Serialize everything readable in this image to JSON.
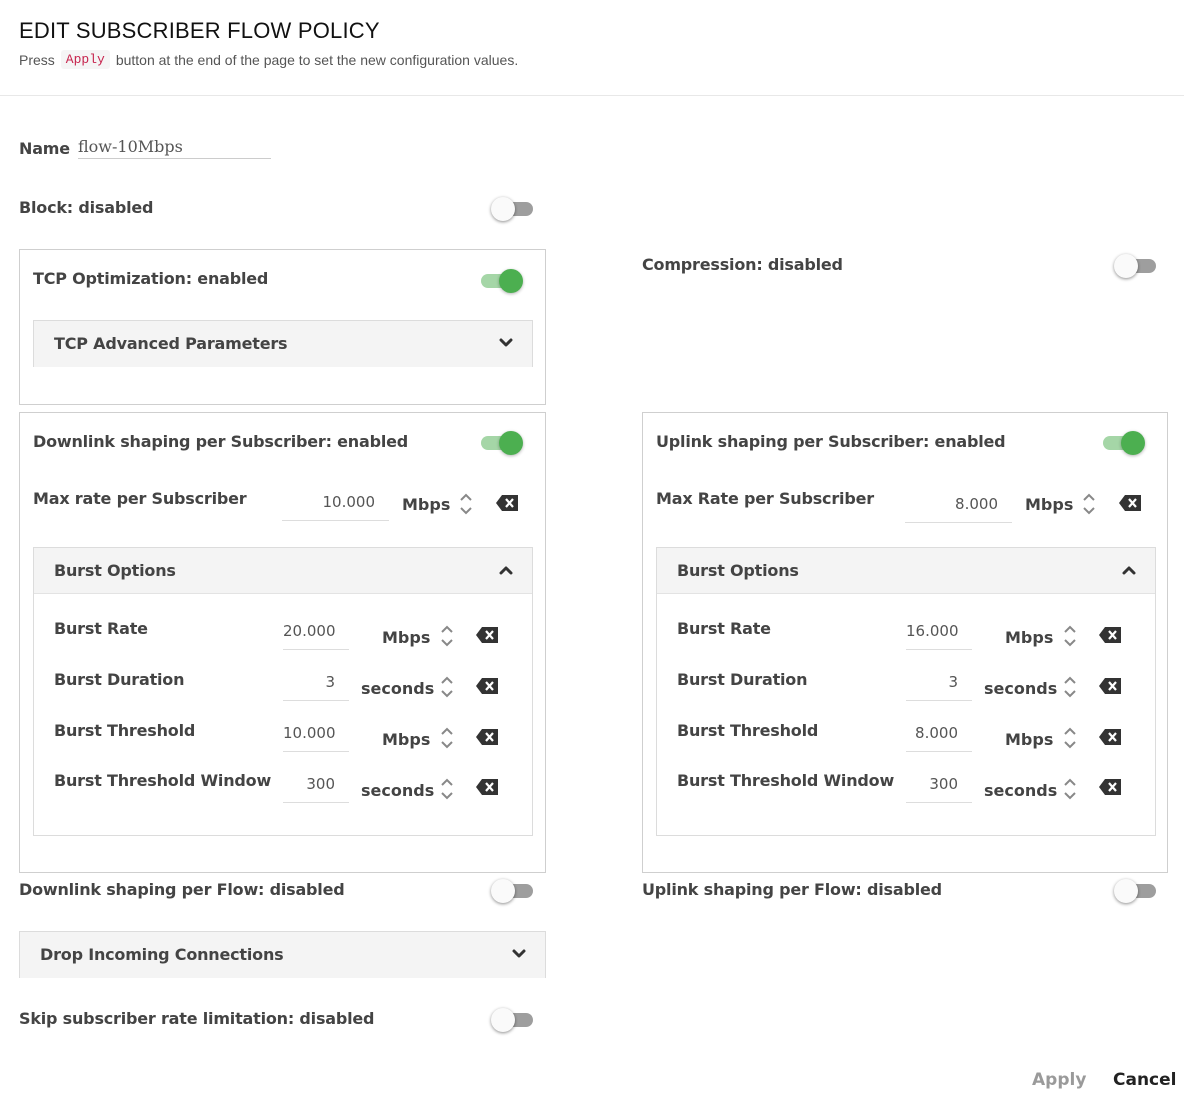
{
  "page": {
    "title": "EDIT SUBSCRIBER FLOW POLICY",
    "subtitle_before": "Press",
    "subtitle_code": "Apply",
    "subtitle_after": "button at the end of the page to set the new configuration values."
  },
  "name": {
    "label": "Name",
    "value": "flow-10Mbps"
  },
  "block": {
    "label": "Block: disabled",
    "enabled": false
  },
  "tcp": {
    "label": "TCP Optimization: enabled",
    "enabled": true,
    "advanced_title": "TCP Advanced Parameters"
  },
  "compression": {
    "label": "Compression: disabled",
    "enabled": false
  },
  "downlink": {
    "label": "Downlink shaping per Subscriber: enabled",
    "enabled": true,
    "max_rate_label": "Max rate per Subscriber",
    "max_rate_value": "10.000",
    "max_rate_unit": "Mbps",
    "burst": {
      "title": "Burst Options",
      "rows": [
        {
          "label": "Burst Rate",
          "value": "20.000",
          "unit": "Mbps"
        },
        {
          "label": "Burst Duration",
          "value": "3",
          "unit": "seconds"
        },
        {
          "label": "Burst Threshold",
          "value": "10.000",
          "unit": "Mbps"
        },
        {
          "label": "Burst Threshold Window",
          "value": "300",
          "unit": "seconds"
        }
      ]
    }
  },
  "uplink": {
    "label": "Uplink shaping per Subscriber: enabled",
    "enabled": true,
    "max_rate_label": "Max Rate per Subscriber",
    "max_rate_value": "8.000",
    "max_rate_unit": "Mbps",
    "burst": {
      "title": "Burst Options",
      "rows": [
        {
          "label": "Burst Rate",
          "value": "16.000",
          "unit": "Mbps"
        },
        {
          "label": "Burst Duration",
          "value": "3",
          "unit": "seconds"
        },
        {
          "label": "Burst Threshold",
          "value": "8.000",
          "unit": "Mbps"
        },
        {
          "label": "Burst Threshold Window",
          "value": "300",
          "unit": "seconds"
        }
      ]
    }
  },
  "downlink_flow": {
    "label": "Downlink shaping per Flow: disabled",
    "enabled": false
  },
  "uplink_flow": {
    "label": "Uplink shaping per Flow: disabled",
    "enabled": false
  },
  "drop_incoming": {
    "title": "Drop Incoming Connections"
  },
  "skip_limitation": {
    "label": "Skip subscriber rate limitation: disabled",
    "enabled": false
  },
  "footer": {
    "apply_label": "Apply",
    "cancel_label": "Cancel"
  },
  "icons": {
    "chevron_down": "chevron-down-icon",
    "chevron_up": "chevron-up-icon",
    "stepper": "stepper-icon",
    "clear": "backspace-clear-icon"
  },
  "colors": {
    "toggle_on": "#4caf50",
    "toggle_on_track": "#a5d6a7",
    "toggle_off_track": "#9e9e9e",
    "code_text": "#c7254e"
  }
}
